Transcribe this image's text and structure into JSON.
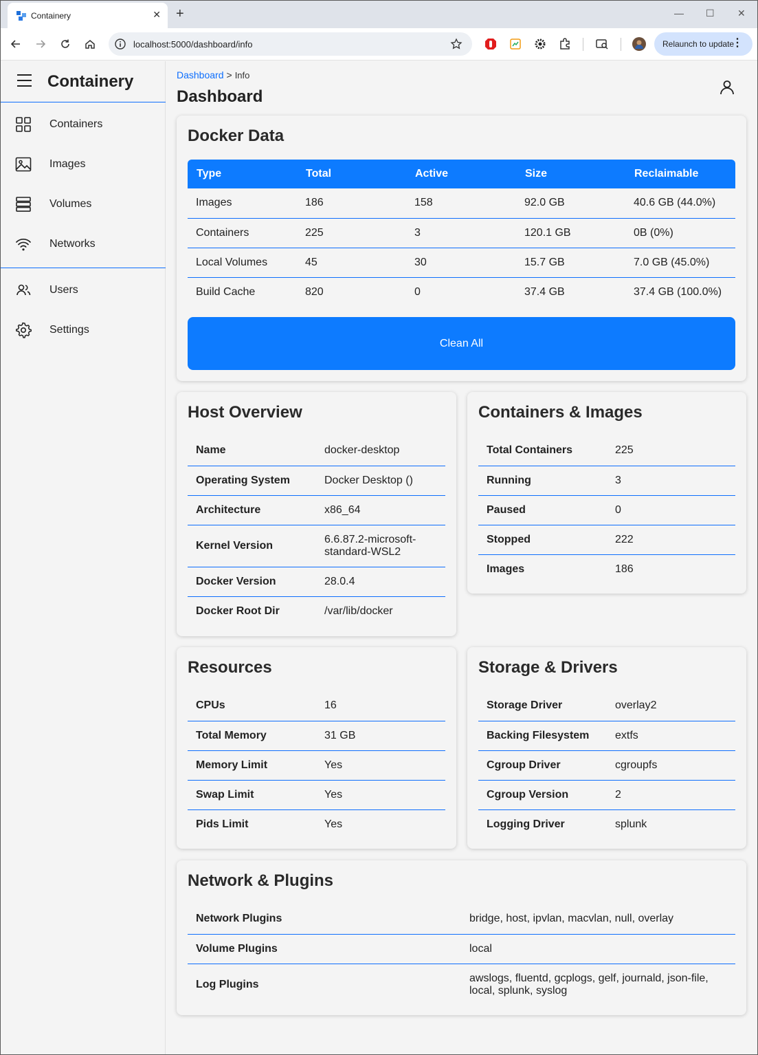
{
  "browser": {
    "tab_title": "Containery",
    "url": "localhost:5000/dashboard/info",
    "relaunch_label": "Relaunch to update"
  },
  "app": {
    "title": "Containery"
  },
  "sidebar": {
    "items": [
      {
        "label": "Containers",
        "icon": "grid-icon"
      },
      {
        "label": "Images",
        "icon": "image-icon"
      },
      {
        "label": "Volumes",
        "icon": "database-icon"
      },
      {
        "label": "Networks",
        "icon": "wifi-icon"
      },
      {
        "label": "Users",
        "icon": "users-icon"
      },
      {
        "label": "Settings",
        "icon": "gear-icon"
      }
    ]
  },
  "breadcrumb": {
    "parent": "Dashboard",
    "separator": ">",
    "current": "Info"
  },
  "page": {
    "title": "Dashboard"
  },
  "docker_data": {
    "title": "Docker Data",
    "columns": [
      "Type",
      "Total",
      "Active",
      "Size",
      "Reclaimable"
    ],
    "rows": [
      [
        "Images",
        "186",
        "158",
        "92.0 GB",
        "40.6 GB (44.0%)"
      ],
      [
        "Containers",
        "225",
        "3",
        "120.1 GB",
        "0B (0%)"
      ],
      [
        "Local Volumes",
        "45",
        "30",
        "15.7 GB",
        "7.0 GB (45.0%)"
      ],
      [
        "Build Cache",
        "820",
        "0",
        "37.4 GB",
        "37.4 GB (100.0%)"
      ]
    ],
    "clean_label": "Clean All"
  },
  "host_overview": {
    "title": "Host Overview",
    "rows": [
      [
        "Name",
        "docker-desktop"
      ],
      [
        "Operating System",
        "Docker Desktop ()"
      ],
      [
        "Architecture",
        "x86_64"
      ],
      [
        "Kernel Version",
        "6.6.87.2-microsoft-standard-WSL2"
      ],
      [
        "Docker Version",
        "28.0.4"
      ],
      [
        "Docker Root Dir",
        "/var/lib/docker"
      ]
    ]
  },
  "containers_images": {
    "title": "Containers & Images",
    "rows": [
      [
        "Total Containers",
        "225"
      ],
      [
        "Running",
        "3"
      ],
      [
        "Paused",
        "0"
      ],
      [
        "Stopped",
        "222"
      ],
      [
        "Images",
        "186"
      ]
    ]
  },
  "resources": {
    "title": "Resources",
    "rows": [
      [
        "CPUs",
        "16"
      ],
      [
        "Total Memory",
        "31 GB"
      ],
      [
        "Memory Limit",
        "Yes"
      ],
      [
        "Swap Limit",
        "Yes"
      ],
      [
        "Pids Limit",
        "Yes"
      ]
    ]
  },
  "storage_drivers": {
    "title": "Storage & Drivers",
    "rows": [
      [
        "Storage Driver",
        "overlay2"
      ],
      [
        "Backing Filesystem",
        "extfs"
      ],
      [
        "Cgroup Driver",
        "cgroupfs"
      ],
      [
        "Cgroup Version",
        "2"
      ],
      [
        "Logging Driver",
        "splunk"
      ]
    ]
  },
  "network_plugins": {
    "title": "Network & Plugins",
    "rows": [
      [
        "Network Plugins",
        "bridge, host, ipvlan, macvlan, null, overlay"
      ],
      [
        "Volume Plugins",
        "local"
      ],
      [
        "Log Plugins",
        "awslogs, fluentd, gcplogs, gelf, journald, json-file, local, splunk, syslog"
      ]
    ]
  },
  "colors": {
    "accent": "#0d7bff",
    "link": "#0d6efd"
  }
}
